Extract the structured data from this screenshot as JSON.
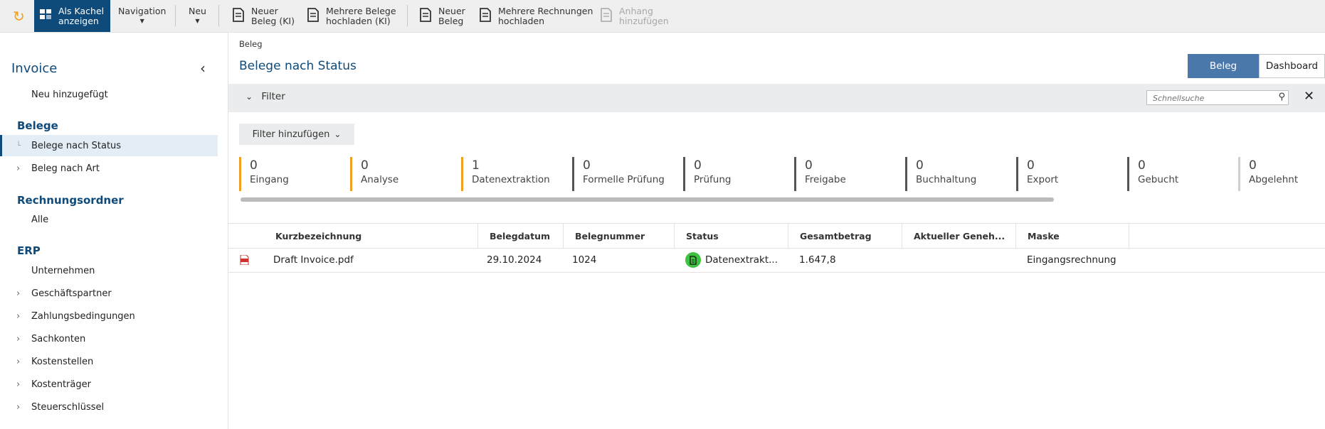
{
  "toolbar": {
    "kachel": "Als Kachel\nanzeigen",
    "kachel_l1": "Als Kachel",
    "kachel_l2": "anzeigen",
    "navigation": "Navigation",
    "neu": "Neu",
    "neuer_beleg_ki_l1": "Neuer",
    "neuer_beleg_ki_l2": "Beleg (KI)",
    "mehrere_belege_l1": "Mehrere Belege",
    "mehrere_belege_l2": "hochladen (KI)",
    "neuer_beleg_l1": "Neuer",
    "neuer_beleg_l2": "Beleg",
    "mehrere_rechnungen_l1": "Mehrere Rechnungen",
    "mehrere_rechnungen_l2": "hochladen",
    "anhang_l1": "Anhang",
    "anhang_l2": "hinzufügen",
    "accent_color": "#0e4a7a",
    "refresh_color": "#f0a020"
  },
  "sidebar": {
    "title": "Invoice",
    "top_item": "Neu hinzugefügt",
    "sections": {
      "belege": "Belege",
      "rechnungsordner": "Rechnungsordner",
      "erp": "ERP"
    },
    "belege_items": [
      "Belege nach Status",
      "Beleg nach Art"
    ],
    "rechnungsordner_items": [
      "Alle"
    ],
    "erp_items": [
      "Unternehmen",
      "Geschäftspartner",
      "Zahlungsbedingungen",
      "Sachkonten",
      "Kostenstellen",
      "Kostenträger",
      "Steuerschlüssel"
    ]
  },
  "main": {
    "breadcrumb": "Beleg",
    "title": "Belege nach Status",
    "view_beleg": "Beleg",
    "view_dashboard": "Dashboard",
    "filter_label": "Filter",
    "search_placeholder": "Schnellsuche",
    "add_filter": "Filter hinzufügen",
    "kpis": [
      {
        "count": "0",
        "label": "Eingang",
        "color": "#f0a020"
      },
      {
        "count": "0",
        "label": "Analyse",
        "color": "#f0a020"
      },
      {
        "count": "1",
        "label": "Datenextraktion",
        "color": "#f0a020"
      },
      {
        "count": "0",
        "label": "Formelle Prüfung",
        "color": "#555555"
      },
      {
        "count": "0",
        "label": "Prüfung",
        "color": "#555555"
      },
      {
        "count": "0",
        "label": "Freigabe",
        "color": "#555555"
      },
      {
        "count": "0",
        "label": "Buchhaltung",
        "color": "#555555"
      },
      {
        "count": "0",
        "label": "Export",
        "color": "#555555"
      },
      {
        "count": "0",
        "label": "Gebucht",
        "color": "#555555"
      },
      {
        "count": "0",
        "label": "Abgelehnt",
        "color": "#555555"
      }
    ]
  },
  "table": {
    "columns": [
      "Kurzbezeichnung",
      "Belegdatum",
      "Belegnummer",
      "Status",
      "Gesamtbetrag",
      "Aktueller Geneh...",
      "Maske"
    ],
    "rows": [
      {
        "kurz": "Draft Invoice.pdf",
        "datum": "29.10.2024",
        "nummer": "1024",
        "status": "Datenextrakt...",
        "betrag": "1.647,8",
        "geneh": "",
        "maske": "Eingangsrechnung"
      }
    ]
  }
}
